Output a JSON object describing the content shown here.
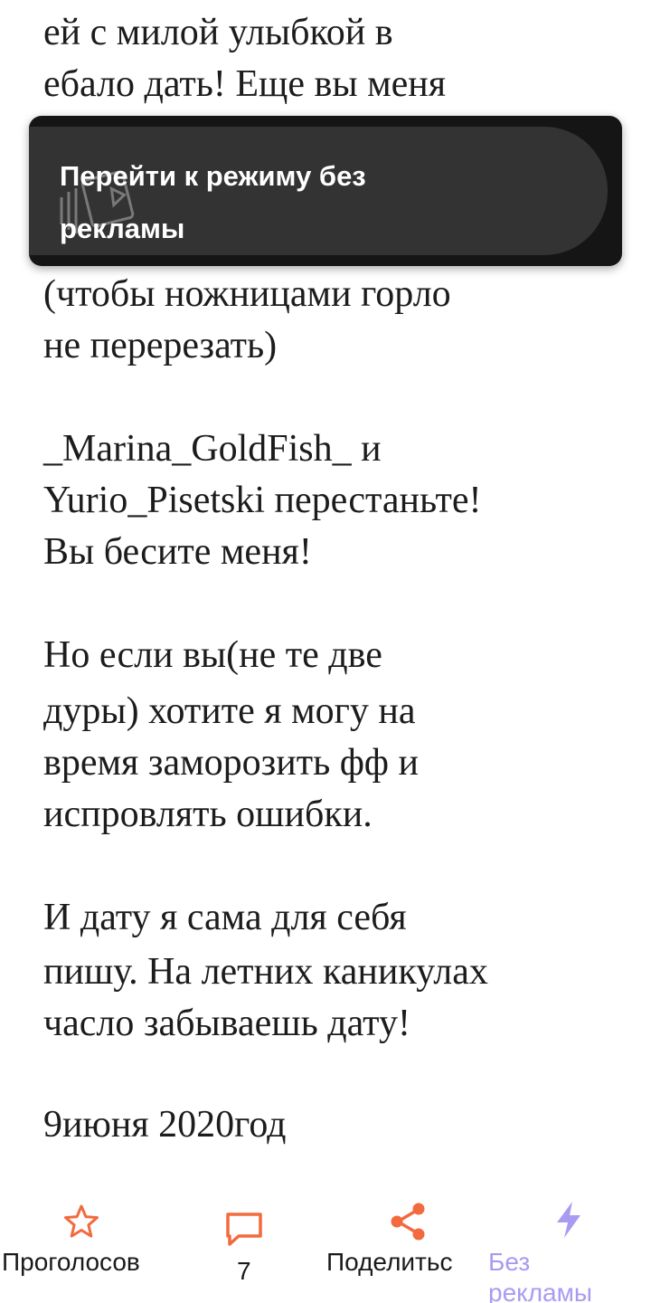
{
  "story": {
    "lines": [
      "ей с милой улыбкой в",
      "ебало дать! Еще вы меня",
      "(чтобы ножницами горло",
      "не перерезать)",
      "_Marina_GoldFish_ и",
      "Yurio_Pisetski перестаньте!",
      "Вы бесите меня!",
      "Но если вы(не те две",
      "дуры) хотите я могу на",
      "время заморозить фф и",
      "испровлять ошибки.",
      "И дату я сама для себя",
      "пишу. На летних каникулах",
      "часло забываешь дату!",
      "9июня 2020год"
    ]
  },
  "toast": {
    "line1": "Перейти к режиму без",
    "line2": "рекламы",
    "icon": "video-icon"
  },
  "bottom_bar": {
    "vote_label": "Проголосов",
    "comments_count": "7",
    "share_label": "Поделитьс",
    "no_ads_line1": "Без",
    "no_ads_line2": "рекламы",
    "accent_color": "#f26a3d",
    "no_ads_color": "#a99bf2"
  }
}
